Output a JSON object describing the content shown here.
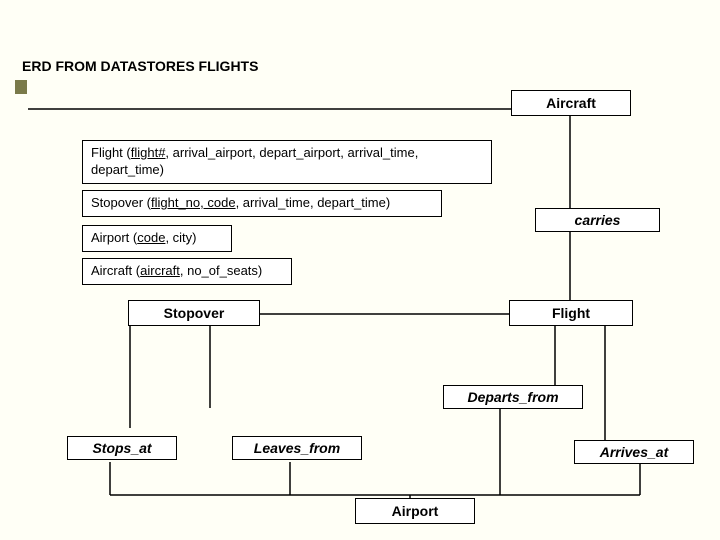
{
  "title": "ERD FROM DATASTORES FLIGHTS",
  "schemas": {
    "flight_pre": "Flight (",
    "flight_key": "flight#,",
    "flight_rest": " arrival_airport, depart_airport, arrival_time, depart_time)",
    "stopover_pre": "Stopover (",
    "stopover_key": "flight_no, code",
    "stopover_rest": ", arrival_time, depart_time)",
    "airport_pre": "Airport (",
    "airport_key": "code",
    "airport_rest": ", city)",
    "aircraft_pre": "Aircraft (",
    "aircraft_key": "aircraft",
    "aircraft_rest": ", no_of_seats)"
  },
  "entities": {
    "aircraft": "Aircraft",
    "stopover": "Stopover",
    "flight": "Flight",
    "airport": "Airport"
  },
  "relationships": {
    "carries": "carries",
    "departs_from": "Departs_from",
    "stops_at": "Stops_at",
    "leaves_from": "Leaves_from",
    "arrives_at": "Arrives_at"
  }
}
